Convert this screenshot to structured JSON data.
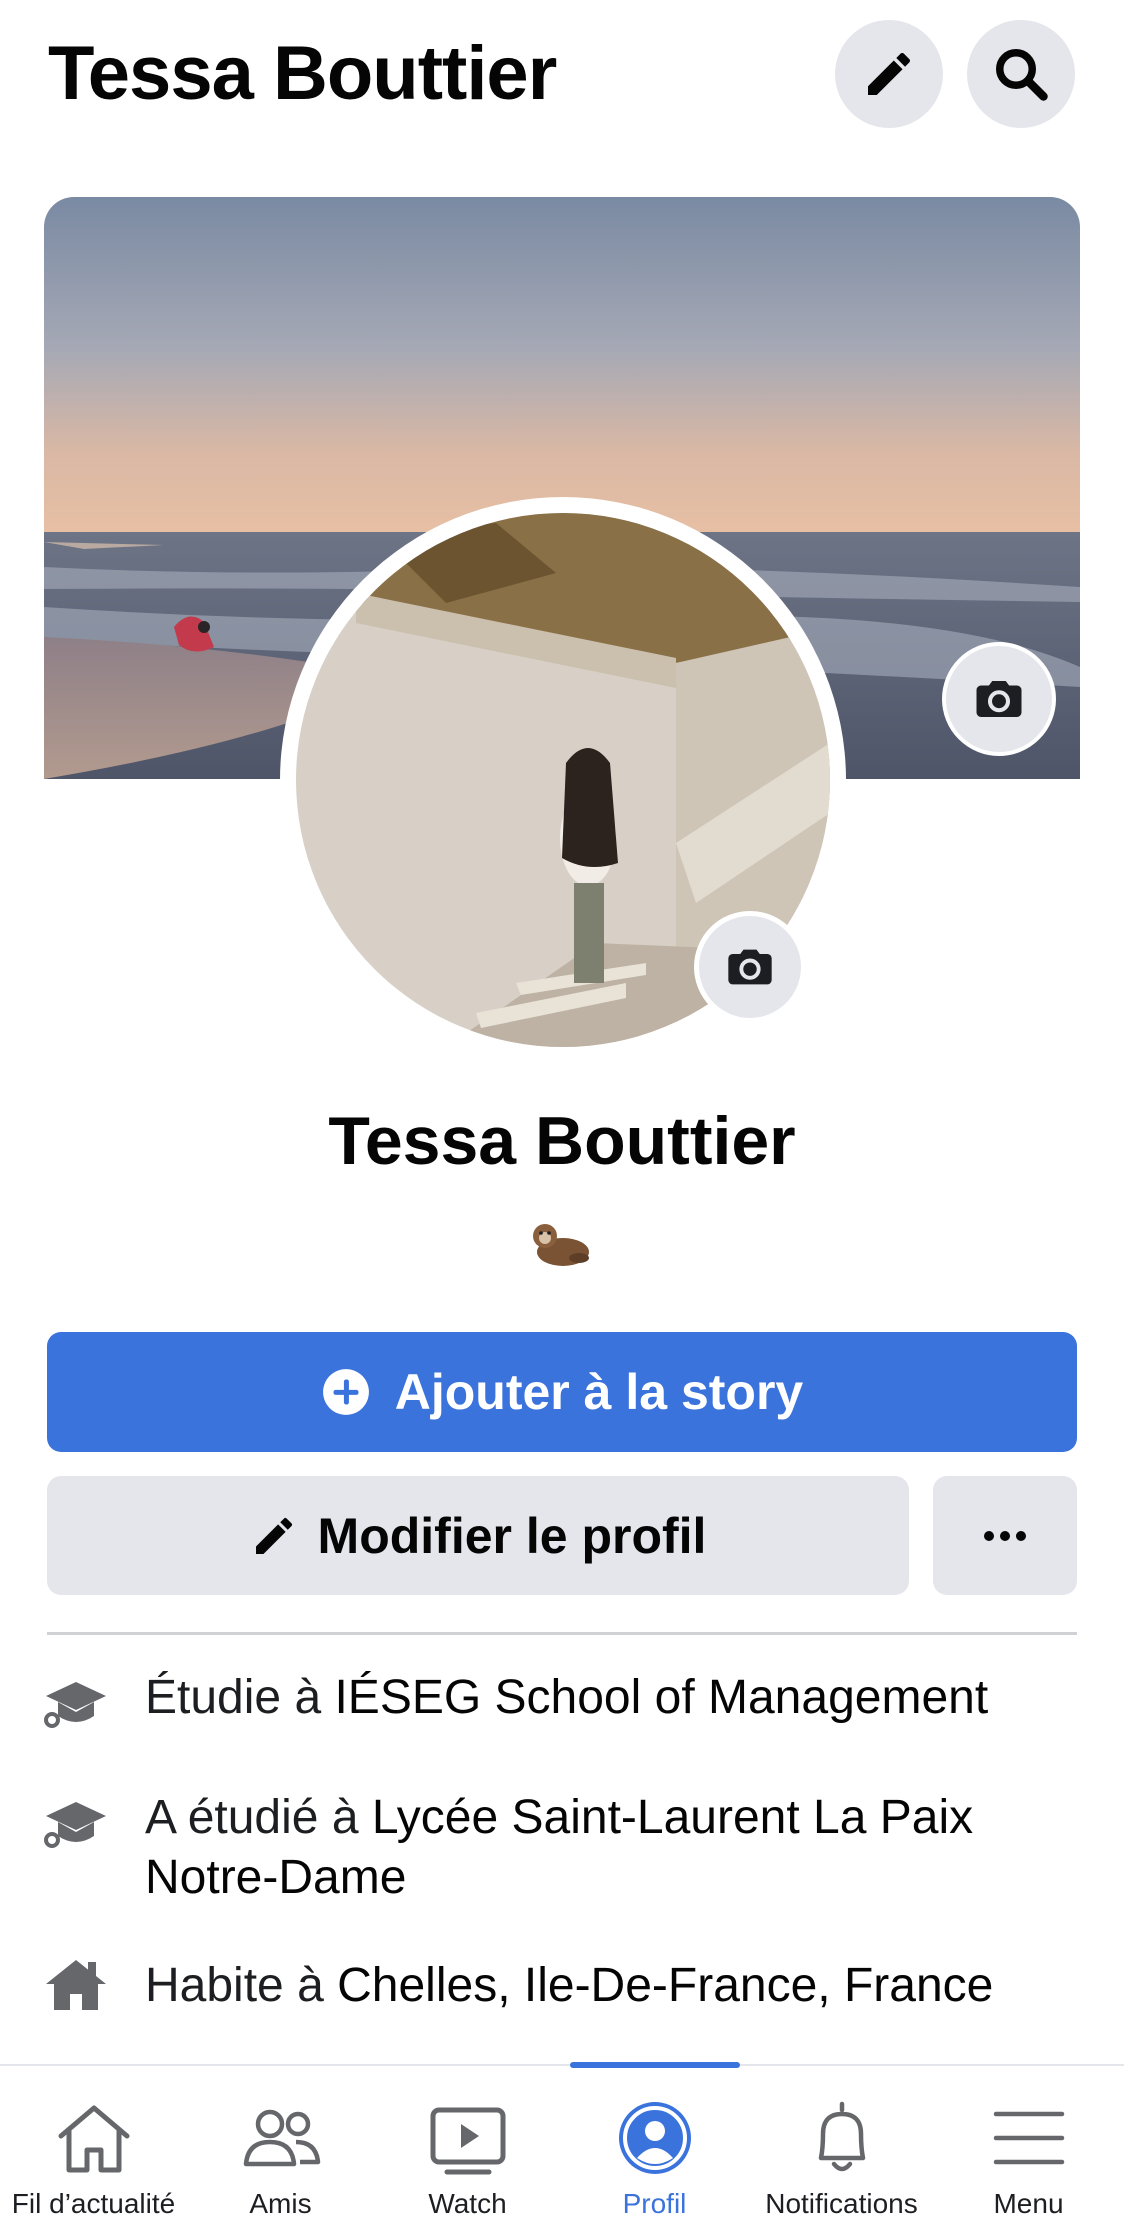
{
  "header": {
    "title": "Tessa Bouttier",
    "edit_icon": "pencil-icon",
    "search_icon": "search-icon"
  },
  "profile": {
    "name": "Tessa Bouttier",
    "bio_emoji": "otter",
    "camera_icon": "camera-icon"
  },
  "actions": {
    "add_story_label": "Ajouter à la story",
    "edit_profile_label": "Modifier le profil",
    "more_icon": "more-icon"
  },
  "details": [
    {
      "icon": "graduation-cap-icon",
      "prefix": "Étudie à ",
      "value": "IÉSEG School of Management"
    },
    {
      "icon": "graduation-cap-icon",
      "prefix": "A étudié à ",
      "value": "Lycée Saint-Laurent La Paix Notre-Dame"
    },
    {
      "icon": "home-icon",
      "prefix": "Habite à ",
      "value": "Chelles, Ile-De-France, France"
    }
  ],
  "nav": {
    "items": [
      {
        "label": "Fil d’actualité",
        "icon": "home-icon"
      },
      {
        "label": "Amis",
        "icon": "friends-icon"
      },
      {
        "label": "Watch",
        "icon": "watch-icon"
      },
      {
        "label": "Profil",
        "icon": "profile-icon"
      },
      {
        "label": "Notifications",
        "icon": "bell-icon"
      },
      {
        "label": "Menu",
        "icon": "menu-icon"
      }
    ],
    "active": "Profil"
  },
  "colors": {
    "accent": "#3b73dd",
    "button_gray": "#e4e6eb",
    "text": "#050505"
  }
}
